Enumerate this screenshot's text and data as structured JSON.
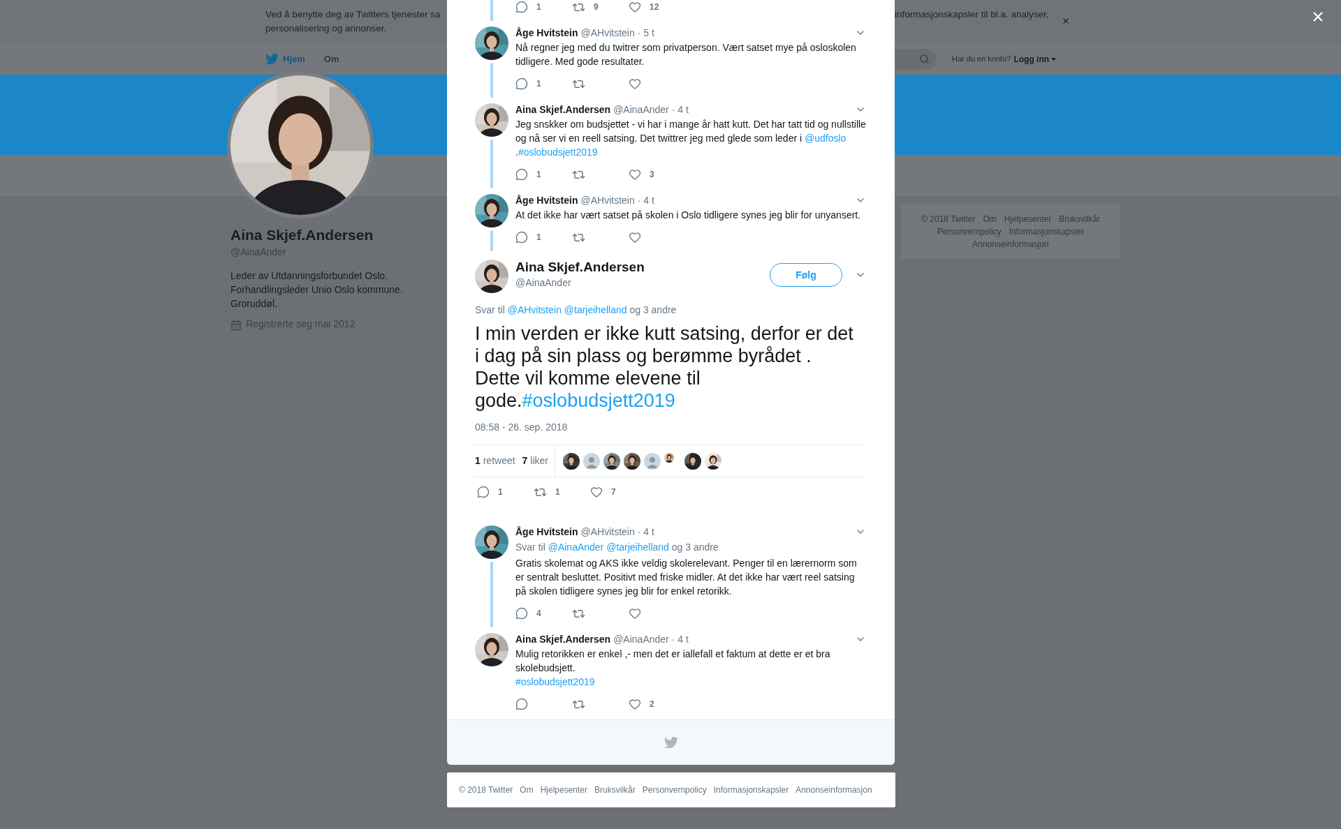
{
  "cookie_banner": {
    "lines_left": [
      "Ved å benytte deg av Twitters tjenester sa",
      "personalisering og annonser."
    ],
    "text_right": "informasjonskapsler til bl.a. analyser,"
  },
  "nav": {
    "items": [
      {
        "label": "Hjem",
        "kind": "home"
      },
      {
        "label": "Om",
        "kind": "link"
      }
    ],
    "account_prompt": "Har du en konto?",
    "login": "Logg inn"
  },
  "profile": {
    "avatar": {
      "kind": "picture",
      "color": "#cfc9c4"
    },
    "name": "Aina Skjef.Andersen",
    "handle": "@AinaAnder",
    "bio": "Leder av Utdanningsforbundet Oslo. Forhandlingsleder Unio Oslo kommune. Groruddøl.",
    "joined": "Registrerte seg mai 2012"
  },
  "side_footer": {
    "links": [
      "© 2018 Twitter",
      "Om",
      "Hjelpesenter",
      "Bruksvilkår",
      "Personvernpolicy",
      "Informasjonskapsler",
      "Annonseinformasjon"
    ]
  },
  "conversation": {
    "partial": {
      "connected": true,
      "actions": {
        "replies": "1",
        "retweets": "9",
        "likes": "12"
      }
    },
    "replies_above": [
      {
        "name": "Åge Hvitstein",
        "handle": "@AHvitstein",
        "time": "· 5 t",
        "connected": true,
        "avatar": {
          "kind": "picture",
          "color": "#4f9aa8"
        },
        "body": [
          {
            "kind": "text",
            "text": "Nå regner jeg med du twitrer som privatperson. Vært satset mye på osloskolen tidligere. Med gode resultater."
          }
        ],
        "actions": {
          "replies": "1"
        }
      },
      {
        "name": "Aina Skjef.Andersen",
        "handle": "@AinaAnder",
        "time": "· 4 t",
        "connected": true,
        "avatar": {
          "kind": "picture",
          "color": "#cfc9c4"
        },
        "body": [
          {
            "kind": "text",
            "text": "Jeg snskker om budsjettet - vi har i mange år hatt kutt. Det har tatt tid og nullstille og nå ser vi en reell satsing. Det twittrer jeg med glede som leder i "
          },
          {
            "kind": "mention",
            "text": "@udfoslo"
          },
          {
            "kind": "text",
            "text": " ."
          },
          {
            "kind": "hashtag",
            "text": "#oslobudsjett2019"
          }
        ],
        "actions": {
          "replies": "1",
          "likes": "3"
        }
      },
      {
        "name": "Åge Hvitstein",
        "handle": "@AHvitstein",
        "time": "· 4 t",
        "connected": true,
        "avatar": {
          "kind": "picture",
          "color": "#4f9aa8"
        },
        "body": [
          {
            "kind": "text",
            "text": "At det ikke har vært satset på skolen i Oslo tidligere synes jeg blir for unyansert."
          }
        ],
        "actions": {
          "replies": "1"
        }
      }
    ],
    "main": {
      "name": "Aina Skjef.Andersen",
      "handle": "@AinaAnder",
      "avatar": {
        "kind": "picture",
        "color": "#cfc9c4"
      },
      "follow": "Følg",
      "reply_to": {
        "label": "Svar til",
        "mentions": [
          "@AHvitstein",
          "@tarjeihelland"
        ],
        "others": "og 3 andre"
      },
      "body": [
        {
          "kind": "text",
          "text": "I min verden er ikke kutt satsing, derfor er det i dag på sin plass og berømme byrådet . Dette vil komme elevene til gode."
        },
        {
          "kind": "hashtag",
          "text": "#oslobudsjett2019"
        }
      ],
      "date": "08:58 - 26. sep. 2018",
      "retweets": {
        "count": "1",
        "label": "retweet"
      },
      "likes": {
        "count": "7",
        "label": "liker"
      },
      "likers": [
        {
          "kind": "picture",
          "color": "#3b3a38"
        },
        {
          "kind": "default"
        },
        {
          "kind": "picture",
          "color": "#7d8a8c"
        },
        {
          "kind": "picture",
          "color": "#6b5a48"
        },
        {
          "kind": "default"
        },
        {
          "kind": "small",
          "color": "#d9b48a"
        },
        {
          "kind": "picture",
          "color": "#2a2a2e"
        },
        {
          "kind": "picture",
          "color": "#f0e4dc"
        }
      ],
      "actions": {
        "replies": "1",
        "retweets": "1",
        "likes": "7"
      }
    },
    "replies_below": [
      {
        "name": "Åge Hvitstein",
        "handle": "@AHvitstein",
        "time": "· 4 t",
        "connected": true,
        "avatar": {
          "kind": "picture",
          "color": "#4f9aa8"
        },
        "reply_to": {
          "label": "Svar til",
          "mentions": [
            "@AinaAnder",
            "@tarjeihelland"
          ],
          "others": "og 3 andre"
        },
        "body": [
          {
            "kind": "text",
            "text": "Gratis skolemat og AKS ikke veldig skolerelevant. Penger til en lærernorm som er sentralt besluttet. Positivt med friske midler. At det ikke har vært reel satsing på skolen tidligere synes jeg blir for enkel retorikk."
          }
        ],
        "actions": {
          "replies": "4"
        }
      },
      {
        "name": "Aina Skjef.Andersen",
        "handle": "@AinaAnder",
        "time": "· 4 t",
        "connected": false,
        "avatar": {
          "kind": "picture",
          "color": "#cfc9c4"
        },
        "body": [
          {
            "kind": "text",
            "text": "Mulig retorikken er enkel ,- men det er iallefall et faktum at dette er et bra skolebudsjett.\n"
          },
          {
            "kind": "hashtag",
            "text": "#oslobudsjett2019"
          }
        ],
        "actions": {
          "likes": "2"
        }
      }
    ]
  },
  "footer": {
    "links": [
      "© 2018 Twitter",
      "Om",
      "Hjelpesenter",
      "Bruksvilkår",
      "Personvernpolicy",
      "Informasjonskapsler",
      "Annonseinformasjon"
    ]
  }
}
